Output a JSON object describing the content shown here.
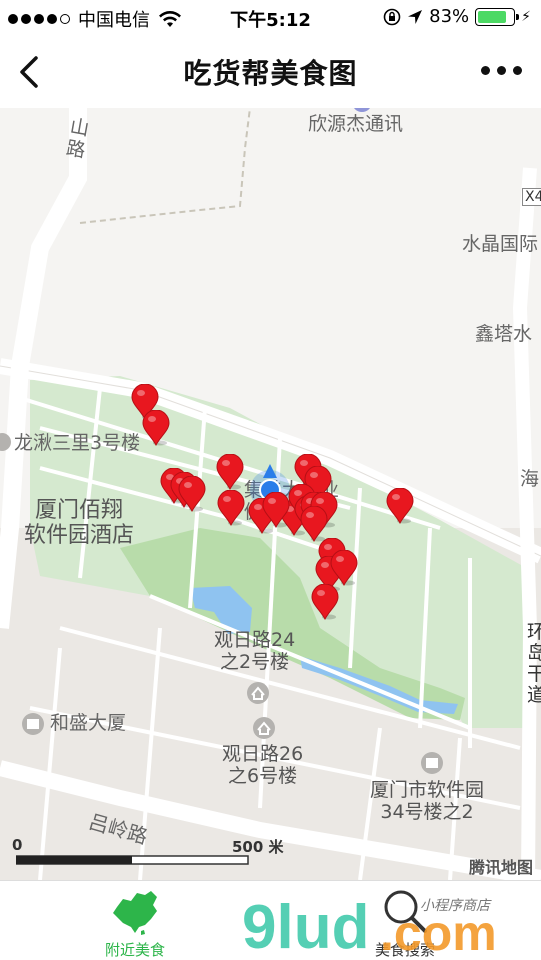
{
  "status_bar": {
    "carrier": "中国电信",
    "time": "下午5:12",
    "battery": "83%",
    "battery_level": 0.83,
    "icons": [
      "signal-dots",
      "wifi-icon",
      "rotation-lock-icon",
      "location-arrow-icon",
      "battery-icon",
      "charging-icon"
    ]
  },
  "nav": {
    "title": "吃货帮美食图",
    "back_icon": "chevron-left-icon",
    "more_icon": "more-dots-icon"
  },
  "map": {
    "labels": {
      "xinyuanjie": "欣源杰通讯",
      "shuijing": "水晶国际",
      "xinta": "鑫塔水",
      "hai": "海",
      "longqiu": "龙湫三里3号楼",
      "hotel": "厦门佰翔\n软件园酒店",
      "guanri24": "观日路24\n之2号楼",
      "hesheng": "和盛大厦",
      "guanri26": "观日路26\n之6号楼",
      "software34": "厦门市软件园\n34号楼之2",
      "luling": "吕岭路",
      "shanlu": "山路",
      "industry": "集美大产业\n促进",
      "huandao": "环\n岛\n干\n道",
      "x4": "X4"
    },
    "scale_zero": "0",
    "scale_label": "500 米",
    "attribution": "腾讯地图",
    "pin_count": 22,
    "pin_color": "#e8171f",
    "user_location_color": "#2b7de9"
  },
  "tabs": [
    {
      "label": "附近美食",
      "icon": "china-map-icon",
      "active": true
    },
    {
      "label": "美食搜索",
      "icon": "magnifier-icon",
      "active": false
    }
  ],
  "watermark": {
    "brand": "9lud.com",
    "tagline": "小程序商店"
  },
  "colors": {
    "accent_green": "#2db54a",
    "park_green": "#cfe8c8",
    "water_blue": "#8fc3f0",
    "road": "#ffffff"
  }
}
